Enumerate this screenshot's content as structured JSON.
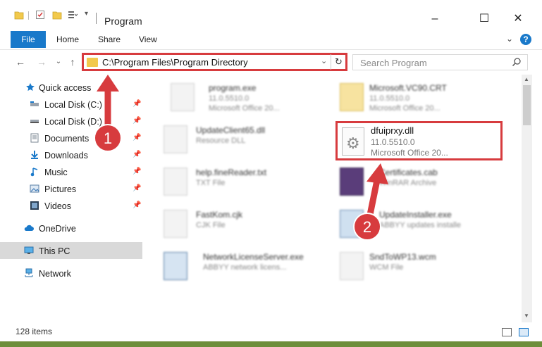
{
  "window": {
    "title": "Program",
    "minimize": "–",
    "maximize": "☐",
    "close": "✕"
  },
  "ribbon": {
    "tabs": [
      "File",
      "Home",
      "Share",
      "View"
    ],
    "collapse": "⌄",
    "help": "?"
  },
  "nav": {
    "back": "←",
    "forward": "→",
    "recent": "⌄",
    "up": "↑",
    "address": "C:\\Program Files\\Program Directory",
    "dropdown": "⌄",
    "refresh": "↻",
    "search_placeholder": "Search Program"
  },
  "sidebar": {
    "items": [
      {
        "label": "Quick access",
        "icon": "star-icon",
        "pinned": false
      },
      {
        "label": "Local Disk (C:)",
        "icon": "drive-icon",
        "pinned": true
      },
      {
        "label": "Local Disk (D:)",
        "icon": "drive-icon",
        "pinned": true
      },
      {
        "label": "Documents",
        "icon": "documents-icon",
        "pinned": true
      },
      {
        "label": "Downloads",
        "icon": "downloads-icon",
        "pinned": true
      },
      {
        "label": "Music",
        "icon": "music-icon",
        "pinned": true
      },
      {
        "label": "Pictures",
        "icon": "pictures-icon",
        "pinned": true
      },
      {
        "label": "Videos",
        "icon": "videos-icon",
        "pinned": true
      },
      {
        "label": "OneDrive",
        "icon": "cloud-icon",
        "pinned": false
      },
      {
        "label": "This PC",
        "icon": "computer-icon",
        "pinned": false,
        "selected": true
      },
      {
        "label": "Network",
        "icon": "network-icon",
        "pinned": false
      }
    ],
    "pin_glyph": "📌"
  },
  "files": [
    {
      "name": "program.exe",
      "line1": "11.0.5510.0",
      "line2": "Microsoft Office 20..."
    },
    {
      "name": "Microsoft.VC90.CRT",
      "line1": "11.0.5510.0",
      "line2": "Microsoft Office 20..."
    },
    {
      "name": "UpdateClient65.dll",
      "line1": "Resource DLL",
      "line2": ""
    },
    {
      "name": "help.fineReader.txt",
      "line1": "TXT File",
      "line2": ""
    },
    {
      "name": "Certificates.cab",
      "line1": "WinRAR Archive",
      "line2": ""
    },
    {
      "name": "FastKom.cjk",
      "line1": "CJK File",
      "line2": ""
    },
    {
      "name": "UpdateInstaller.exe",
      "line1": "ABBYY updates installe",
      "line2": ""
    },
    {
      "name": "NetworkLicenseServer.exe",
      "line1": "ABBYY network licens...",
      "line2": ""
    },
    {
      "name": "SndToWP13.wcm",
      "line1": "WCM File",
      "line2": ""
    }
  ],
  "highlighted_file": {
    "name": "dfuiprxy.dll",
    "version": "11.0.5510.0",
    "company": "Microsoft Office 20..."
  },
  "annotations": {
    "step1": "1",
    "step2": "2",
    "color": "#d73b3e"
  },
  "status": {
    "item_count": "128 items"
  },
  "colors": {
    "accent": "#1979ca",
    "highlight_border": "#d73b3e",
    "selection": "#cce8ff"
  }
}
